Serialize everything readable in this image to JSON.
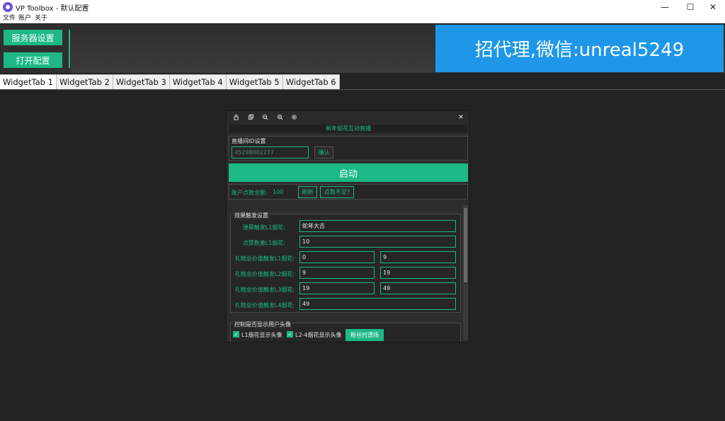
{
  "window": {
    "title": "VP Toolbox - 默认配置",
    "min_glyph": "—",
    "max_glyph": "☐",
    "close_glyph": "✕"
  },
  "menu": [
    "文件",
    "账户",
    "关于"
  ],
  "toolbar": {
    "server_settings": "服务器设置",
    "open_config": "打开配置"
  },
  "banner": "招代理,微信:unreal5249",
  "tabs": [
    "WidgetTab 1",
    "WidgetTab 2",
    "WidgetTab 3",
    "WidgetTab 4",
    "WidgetTab 5",
    "WidgetTab 6"
  ],
  "panel": {
    "icons": {
      "lock": "lock-icon",
      "copy": "copy-icon",
      "zoom_out": "zoom-out-icon",
      "zoom_in": "zoom-in-icon",
      "settings": "gear-icon",
      "close": "close-icon"
    },
    "title": "新年烟花互动直播",
    "room_id_group": {
      "label": "直播间ID设置",
      "placeholder": "45298002277",
      "confirm": "确认"
    },
    "start": "启动",
    "balance": {
      "label": "账户点数余额:",
      "value": "100",
      "refresh": "刷新",
      "insufficient": "点数不足?"
    },
    "effect_group": {
      "label": "效果触发设置",
      "rows": [
        {
          "label": "弹幕触发L1烟花:",
          "value": "蛇年大吉"
        },
        {
          "label": "点赞数量L1烟花:",
          "value": "10"
        },
        {
          "label": "礼物总价值触发L1烟花:",
          "value": "0",
          "value2": "9"
        },
        {
          "label": "礼物总价值触发L2烟花:",
          "value": "9",
          "value2": "19"
        },
        {
          "label": "礼物总价值触发L3烟花:",
          "value": "19",
          "value2": "49"
        },
        {
          "label": "礼物总价值触发L4烟花:",
          "value": "49"
        }
      ]
    },
    "avatar_group": {
      "label": "控制是否显示用户头像",
      "check1": "L1烟花显示头像",
      "check2": "L2-4烟花显示头像",
      "button": "粉丝时透场"
    }
  },
  "colors": {
    "accent": "#1db886",
    "banner": "#1e97e8",
    "background": "#232323"
  }
}
